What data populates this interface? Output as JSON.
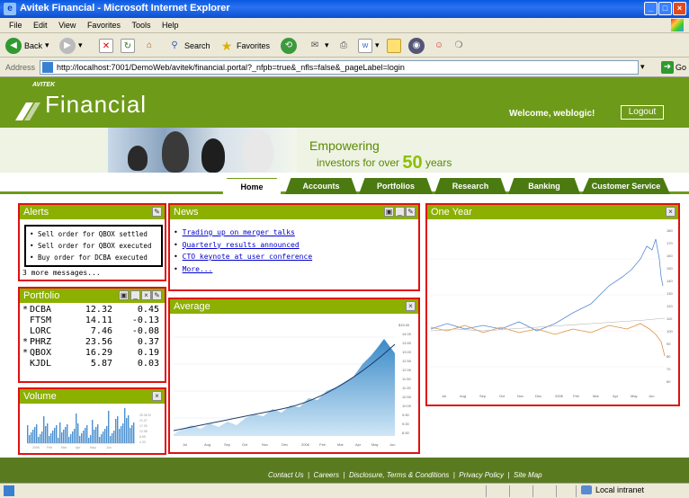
{
  "window": {
    "title": "Avitek Financial - Microsoft Internet Explorer"
  },
  "menu": [
    "File",
    "Edit",
    "View",
    "Favorites",
    "Tools",
    "Help"
  ],
  "toolbar": {
    "back": "Back",
    "search": "Search",
    "favorites": "Favorites"
  },
  "address": {
    "label": "Address",
    "url": "http://localhost:7001/DemoWeb/avitek/financial.portal?_nfpb=true&_nfls=false&_pageLabel=login",
    "go": "Go"
  },
  "header": {
    "brand_small": "AVITEK",
    "brand": "Financial",
    "welcome": "Welcome, weblogic!",
    "logout": "Logout"
  },
  "banner": {
    "tagline1": "Empowering",
    "tagline2_pre": "investors for over",
    "tagline2_num": "50",
    "tagline2_post": "years"
  },
  "tabs": [
    "Home",
    "Accounts",
    "Portfolios",
    "Research",
    "Banking",
    "Customer Service"
  ],
  "alerts": {
    "title": "Alerts",
    "items": [
      "Sell order for QBOX settled",
      "Sell order for QBOX executed",
      "Buy order for DCBA executed"
    ],
    "more": "3 more messages..."
  },
  "news": {
    "title": "News",
    "items": [
      "Trading up on merger talks",
      "Quarterly results announced",
      "CTO keynote at user conference",
      "More..."
    ]
  },
  "portfolio": {
    "title": "Portfolio",
    "rows": [
      {
        "mark": "*",
        "sym": "DCBA",
        "price": "12.32",
        "chg": "0.45"
      },
      {
        "mark": "",
        "sym": "FTSM",
        "price": "14.11",
        "chg": "-0.13"
      },
      {
        "mark": "",
        "sym": "LORC",
        "price": "7.46",
        "chg": "-0.08"
      },
      {
        "mark": "*",
        "sym": "PHRZ",
        "price": "23.56",
        "chg": "0.37"
      },
      {
        "mark": "*",
        "sym": "QBOX",
        "price": "16.29",
        "chg": "0.19"
      },
      {
        "mark": "",
        "sym": "KJDL",
        "price": "5.87",
        "chg": "0.03"
      }
    ]
  },
  "volume": {
    "title": "Volume"
  },
  "average": {
    "title": "Average"
  },
  "oneyear": {
    "title": "One Year"
  },
  "footer": {
    "links": [
      "Contact Us",
      "Careers",
      "Disclosure, Terms & Conditions",
      "Privacy Policy",
      "Site Map"
    ]
  },
  "status": {
    "zone": "Local intranet"
  },
  "colors": {
    "brand_green": "#6e9a1a",
    "portlet_header": "#8cb000",
    "highlight_border": "#e01010"
  }
}
